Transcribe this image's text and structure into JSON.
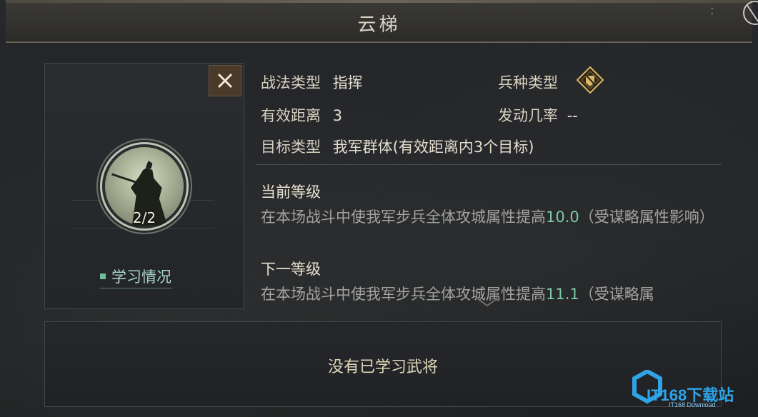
{
  "title": "云梯",
  "tactic": {
    "type_label": "战法类型",
    "type_value": "指挥",
    "troop_label": "兵种类型",
    "range_label": "有效距离",
    "range_value": "3",
    "trigger_label": "发动几率",
    "trigger_value": "--",
    "target_label": "目标类型",
    "target_value": "我军群体(有效距离内3个目标)"
  },
  "general": {
    "level": "2/2",
    "learn_status": "学习情况"
  },
  "current_level": {
    "heading": "当前等级",
    "desc_prefix": "在本场战斗中使我军步兵全体攻城属性提高",
    "value": "10.0",
    "desc_suffix": "（受谋略属性影响）"
  },
  "next_level": {
    "heading": "下一等级",
    "desc_prefix": "在本场战斗中使我军步兵全体攻城属性提高",
    "value": "11.1",
    "desc_suffix": "（受谋略属"
  },
  "learned": {
    "empty_text": "没有已学习武将"
  },
  "watermark": {
    "brand": "IT168下载站",
    "sub": "IT168 Download"
  },
  "colors": {
    "highlight": "#7cc9a6",
    "accent_gold": "#e0d7b8"
  },
  "icons": {
    "troop_type": "infantry-shield-icon",
    "close": "close-icon"
  }
}
